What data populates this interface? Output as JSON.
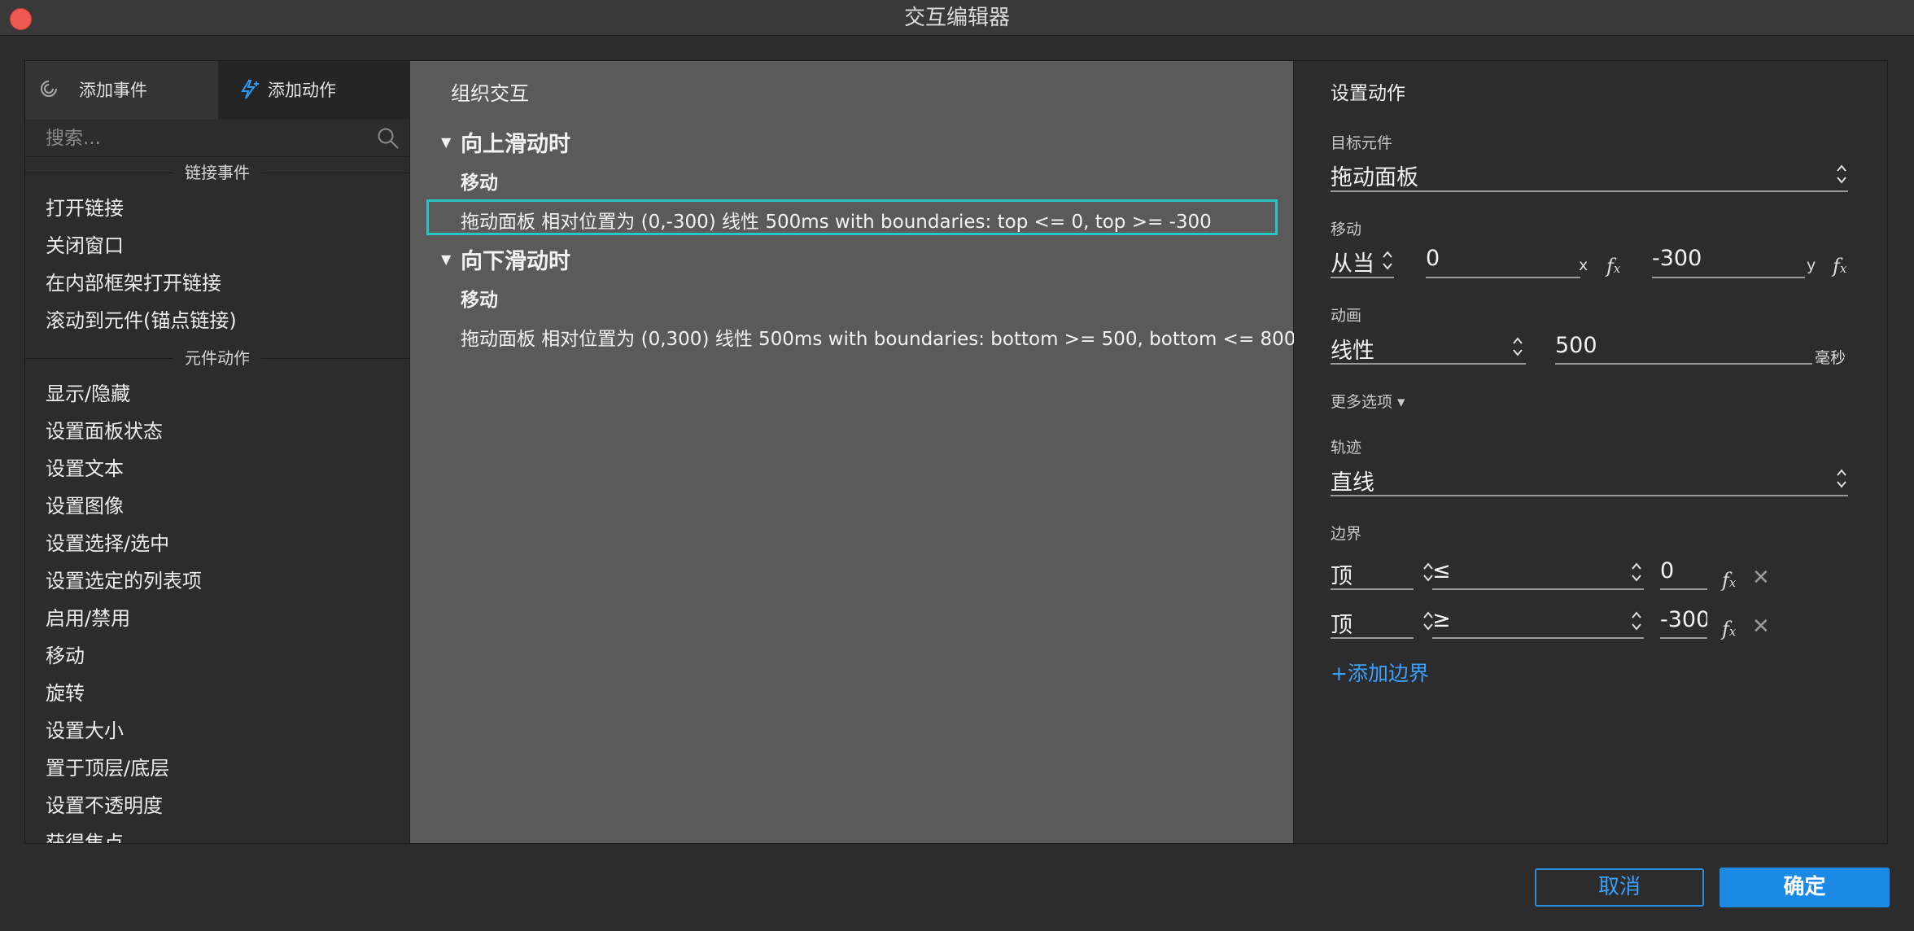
{
  "window": {
    "title": "交互编辑器"
  },
  "left": {
    "tabs": [
      {
        "label": "添加事件",
        "icon": "event-icon"
      },
      {
        "label": "添加动作",
        "icon": "action-bolt-icon",
        "active": true
      }
    ],
    "search": {
      "placeholder": "搜索..."
    },
    "sections": [
      {
        "title": "链接事件",
        "items": [
          "打开链接",
          "关闭窗口",
          "在内部框架打开链接",
          "滚动到元件(锚点链接)"
        ]
      },
      {
        "title": "元件动作",
        "items": [
          "显示/隐藏",
          "设置面板状态",
          "设置文本",
          "设置图像",
          "设置选择/选中",
          "设置选定的列表项",
          "启用/禁用",
          "移动",
          "旋转",
          "设置大小",
          "置于顶层/底层",
          "设置不透明度",
          "获得焦点"
        ]
      }
    ]
  },
  "middle": {
    "title": "组织交互",
    "events": [
      {
        "name": "向上滑动时",
        "action_type": "移动",
        "action_text": "拖动面板 相对位置为 (0,-300) 线性 500ms with boundaries: top <= 0, top >= -300",
        "selected": true
      },
      {
        "name": "向下滑动时",
        "action_type": "移动",
        "action_text": "拖动面板 相对位置为 (0,300) 线性 500ms with boundaries: bottom >= 500, bottom <= 800",
        "selected": false
      }
    ],
    "selection_color": "#27c6c6"
  },
  "right": {
    "title": "设置动作",
    "target": {
      "label": "目标元件",
      "value": "拖动面板"
    },
    "move": {
      "label": "移动",
      "mode": "从当",
      "x": "0",
      "x_unit": "x",
      "y": "-300",
      "y_unit": "y"
    },
    "animation": {
      "label": "动画",
      "easing": "线性",
      "duration": "500",
      "unit": "毫秒"
    },
    "more_options": "更多选项 ▾",
    "path": {
      "label": "轨迹",
      "value": "直线"
    },
    "boundary": {
      "label": "边界",
      "rows": [
        {
          "edge": "顶",
          "op": "≤",
          "value": "0"
        },
        {
          "edge": "顶",
          "op": "≥",
          "value": "-300"
        }
      ],
      "add_label": "+添加边界"
    },
    "fx_label": "fx"
  },
  "footer": {
    "cancel": "取消",
    "ok": "确定"
  },
  "colors": {
    "accent": "#1a8ae6",
    "link": "#3aa0ff",
    "close": "#ee5a52"
  }
}
